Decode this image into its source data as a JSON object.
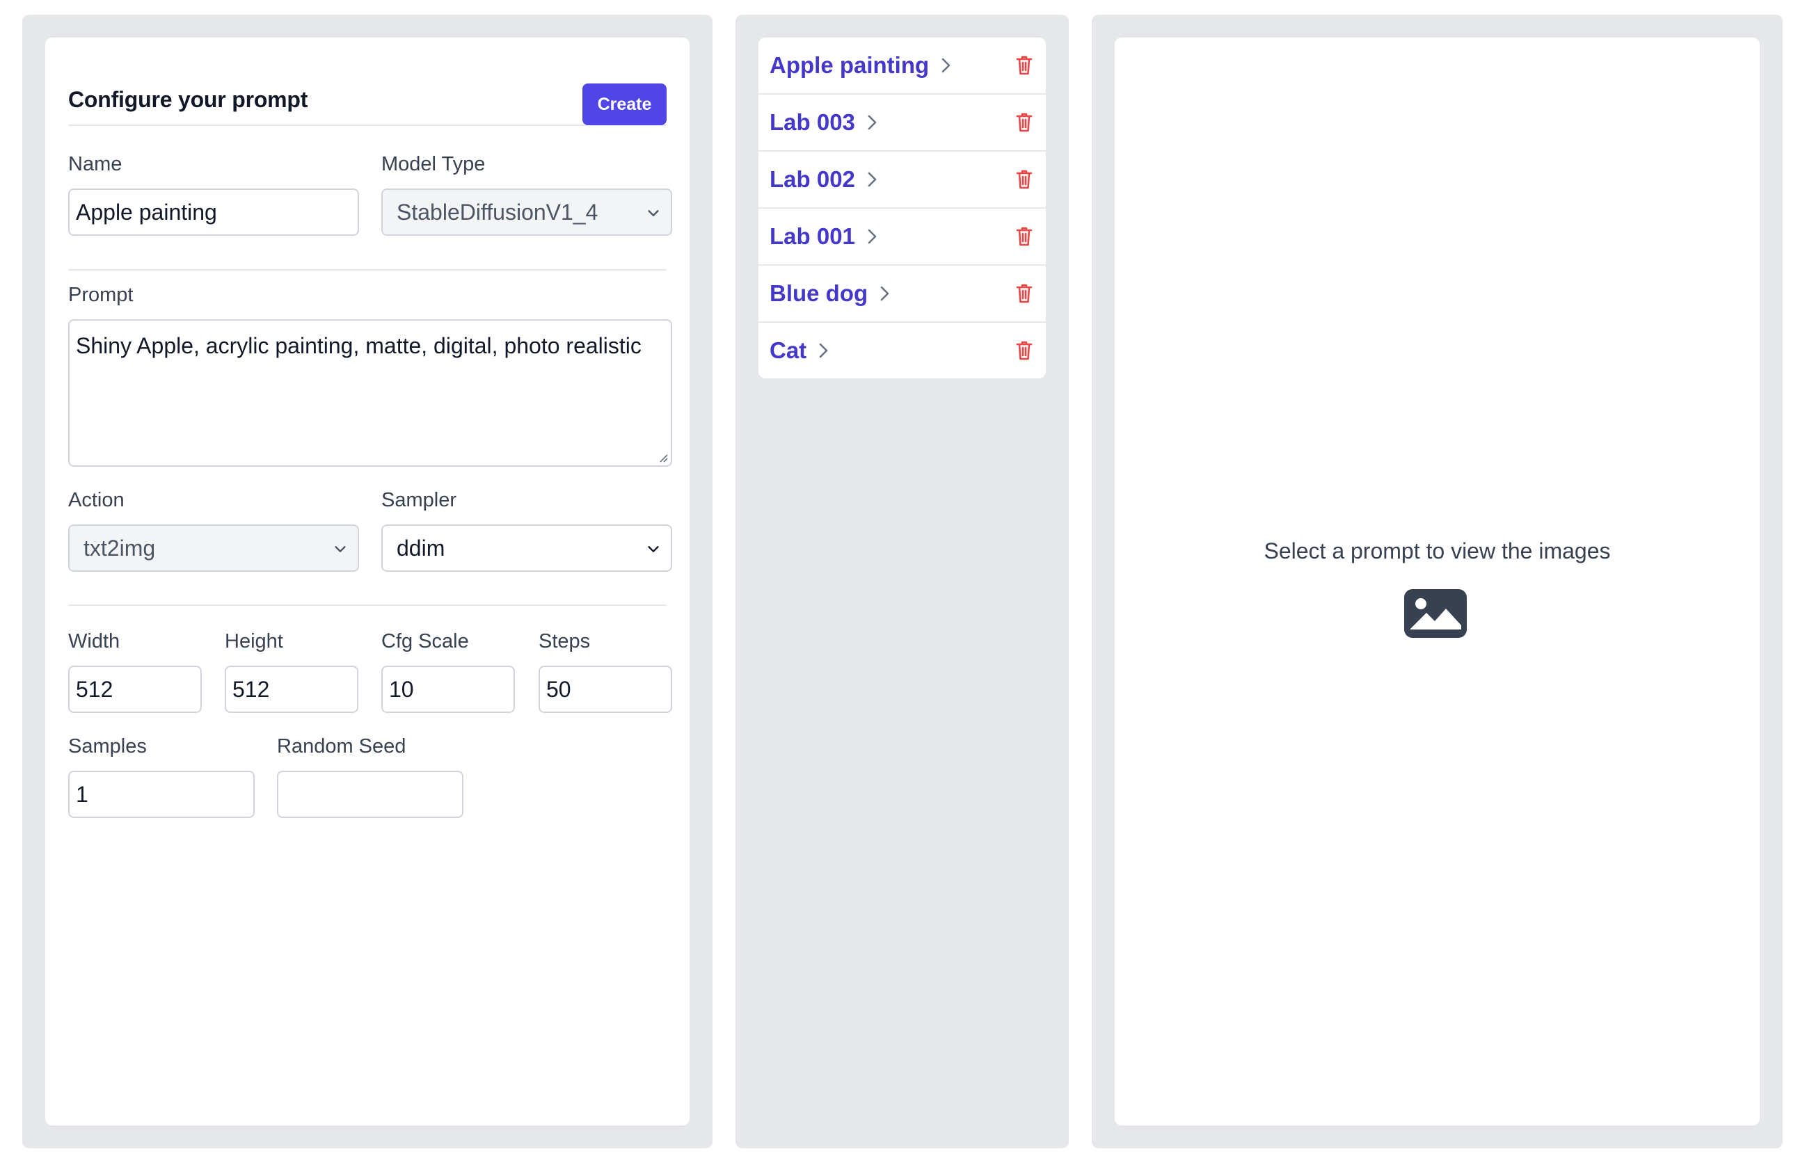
{
  "form": {
    "title": "Configure your prompt",
    "create_label": "Create",
    "name": {
      "label": "Name",
      "value": "Apple painting"
    },
    "model_type": {
      "label": "Model Type",
      "value": "StableDiffusionV1_4"
    },
    "prompt": {
      "label": "Prompt",
      "value": "Shiny Apple, acrylic painting, matte, digital, photo realistic"
    },
    "action": {
      "label": "Action",
      "value": "txt2img"
    },
    "sampler": {
      "label": "Sampler",
      "value": "ddim"
    },
    "width": {
      "label": "Width",
      "value": "512"
    },
    "height": {
      "label": "Height",
      "value": "512"
    },
    "cfg_scale": {
      "label": "Cfg Scale",
      "value": "10"
    },
    "steps": {
      "label": "Steps",
      "value": "50"
    },
    "samples": {
      "label": "Samples",
      "value": "1"
    },
    "random_seed": {
      "label": "Random Seed",
      "value": ""
    }
  },
  "prompts": {
    "items": [
      {
        "label": "Apple painting"
      },
      {
        "label": "Lab 003"
      },
      {
        "label": "Lab 002"
      },
      {
        "label": "Lab 001"
      },
      {
        "label": "Blue dog"
      },
      {
        "label": "Cat"
      }
    ]
  },
  "viewer": {
    "message": "Select a prompt to view the images",
    "icon": "image-icon"
  },
  "colors": {
    "accent": "#4f46e5",
    "link": "#4338ca",
    "danger": "#ef4444",
    "panel_bg": "#e5e7eb"
  }
}
